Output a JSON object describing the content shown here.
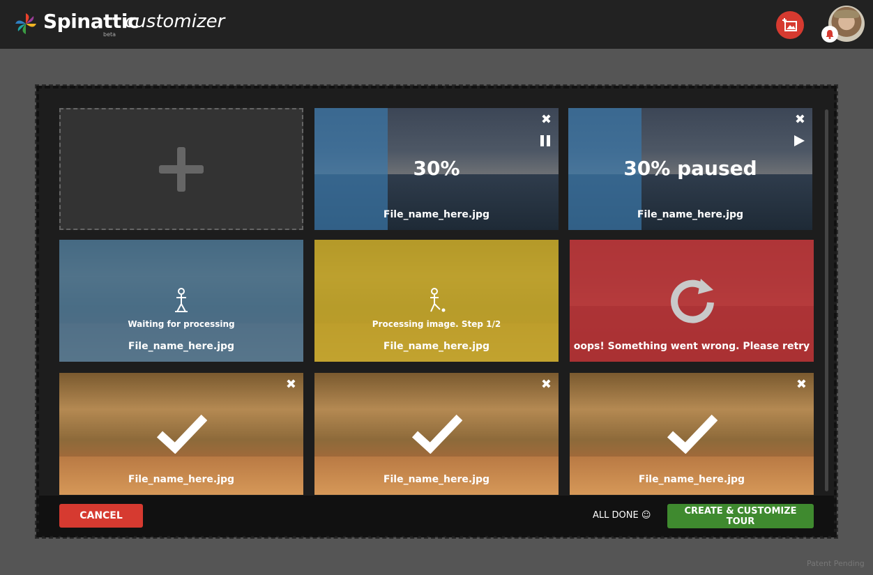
{
  "header": {
    "brand": "Spinattic",
    "beta": "beta",
    "subtitle": "customizer"
  },
  "tiles": {
    "uploading": {
      "percent_label": "30%",
      "progress": 0.3,
      "filename": "File_name_here.jpg"
    },
    "paused": {
      "percent_label": "30% paused",
      "progress": 0.3,
      "filename": "File_name_here.jpg"
    },
    "waiting": {
      "status": "Waiting for processing",
      "filename": "File_name_here.jpg"
    },
    "processing": {
      "status": "Processing image. Step 1/2",
      "filename": "File_name_here.jpg"
    },
    "error": {
      "status": "oops! Something went wrong. Please retry"
    },
    "done": [
      {
        "filename": "File_name_here.jpg"
      },
      {
        "filename": "File_name_here.jpg"
      },
      {
        "filename": "File_name_here.jpg"
      }
    ]
  },
  "footer": {
    "cancel_label": "CANCEL",
    "all_done_label": "ALL DONE ☺",
    "create_label": "CREATE & CUSTOMIZE TOUR"
  },
  "patent": "Patent Pending",
  "colors": {
    "topbar": "#222222",
    "accent_red": "#d63a30",
    "accent_green": "#3f8a2f",
    "waiting_blue": "#3a6e96",
    "processing_yellow": "#bea528",
    "error_red": "#c33232"
  }
}
